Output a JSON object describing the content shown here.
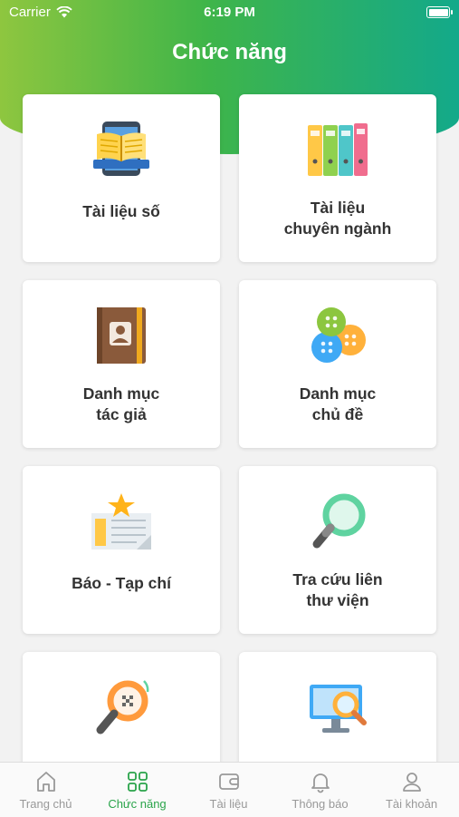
{
  "status_bar": {
    "carrier": "Carrier",
    "time": "6:19 PM"
  },
  "header": {
    "title": "Chức năng"
  },
  "cards": [
    {
      "line1": "Tài liệu số",
      "line2": "",
      "icon": "digital-book-icon"
    },
    {
      "line1": "Tài liệu",
      "line2": "chuyên ngành",
      "icon": "binders-icon"
    },
    {
      "line1": "Danh mục",
      "line2": "tác giả",
      "icon": "author-book-icon"
    },
    {
      "line1": "Danh mục",
      "line2": "chủ đề",
      "icon": "buttons-icon"
    },
    {
      "line1": "Báo - Tạp chí",
      "line2": "",
      "icon": "newspaper-icon"
    },
    {
      "line1": "Tra cứu liên",
      "line2": "thư viện",
      "icon": "magnifier-icon"
    },
    {
      "line1": "",
      "line2": "",
      "icon": "qr-scan-magnifier-icon"
    },
    {
      "line1": "",
      "line2": "",
      "icon": "monitor-search-icon"
    }
  ],
  "tabbar": {
    "active_index": 1,
    "active_color": "#2aa44a",
    "inactive_color": "#999999",
    "tabs": [
      {
        "label": "Trang chủ",
        "icon": "home-icon"
      },
      {
        "label": "Chức năng",
        "icon": "grid-icon"
      },
      {
        "label": "Tài liệu",
        "icon": "wallet-icon"
      },
      {
        "label": "Thông báo",
        "icon": "bell-icon"
      },
      {
        "label": "Tài khoản",
        "icon": "user-icon"
      }
    ]
  },
  "colors": {
    "brand_green": "#3fb549",
    "header_gradient_start": "#8ec63f",
    "header_gradient_end": "#13a98a"
  }
}
